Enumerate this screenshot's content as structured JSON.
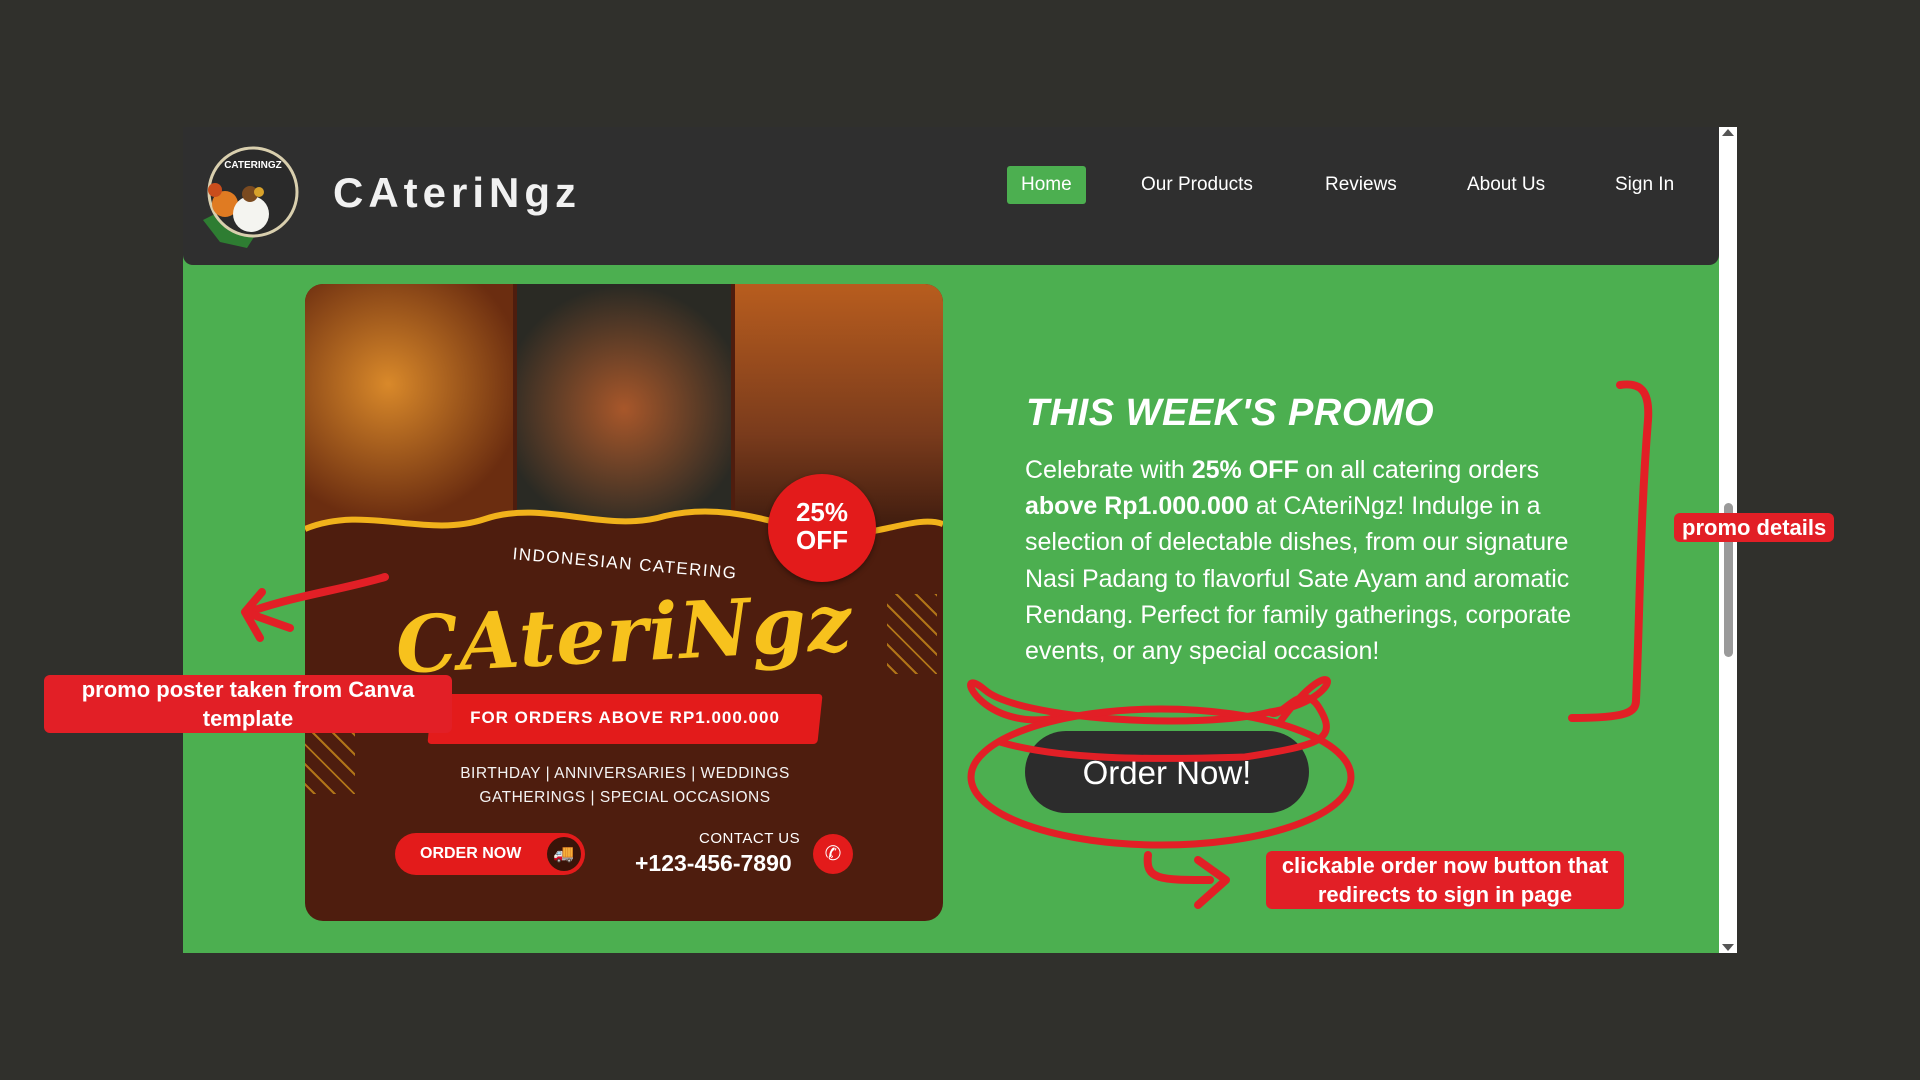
{
  "nav": {
    "logo_text": "CATERINGZ",
    "brand": "CAteriNgz",
    "items": [
      "Home",
      "Our Products",
      "Reviews",
      "About Us",
      "Sign In"
    ],
    "active": "Home"
  },
  "poster": {
    "off_line1": "25%",
    "off_line2": "OFF",
    "subtitle": "INDONESIAN CATERING",
    "brand": "CAteriNgz",
    "strip_text": "FOR ORDERS ABOVE RP1.000.000",
    "occasions_line1": "BIRTHDAY | ANNIVERSARIES | WEDDINGS",
    "occasions_line2": "GATHERINGS | SPECIAL OCCASIONS",
    "order_label": "ORDER NOW",
    "contact_label": "CONTACT US",
    "phone": "+123-456-7890"
  },
  "promo": {
    "title": "THIS WEEK'S PROMO",
    "text_1": "Celebrate with ",
    "bold_1": "25% OFF",
    "text_2": " on all catering orders ",
    "bold_2": "above Rp1.000.000",
    "text_3": " at CAteriNgz! Indulge in a selection of delectable dishes, from our signature Nasi Padang to flavorful Sate Ayam and aromatic Rendang. Perfect for family gatherings, corporate events, or any special occasion!",
    "button": "Order Now!"
  },
  "annotations": {
    "poster_line1": "promo poster taken from Canva",
    "poster_line2": "template",
    "details": "promo details",
    "button_line1": "clickable order now button that",
    "button_line2": "redirects to sign in page"
  },
  "colors": {
    "page_background": "#30302c",
    "navbar": "#2f2f2f",
    "accent_green": "#4caf50",
    "annotation_red": "#e21f26",
    "button_dark": "#2c2c2c"
  }
}
